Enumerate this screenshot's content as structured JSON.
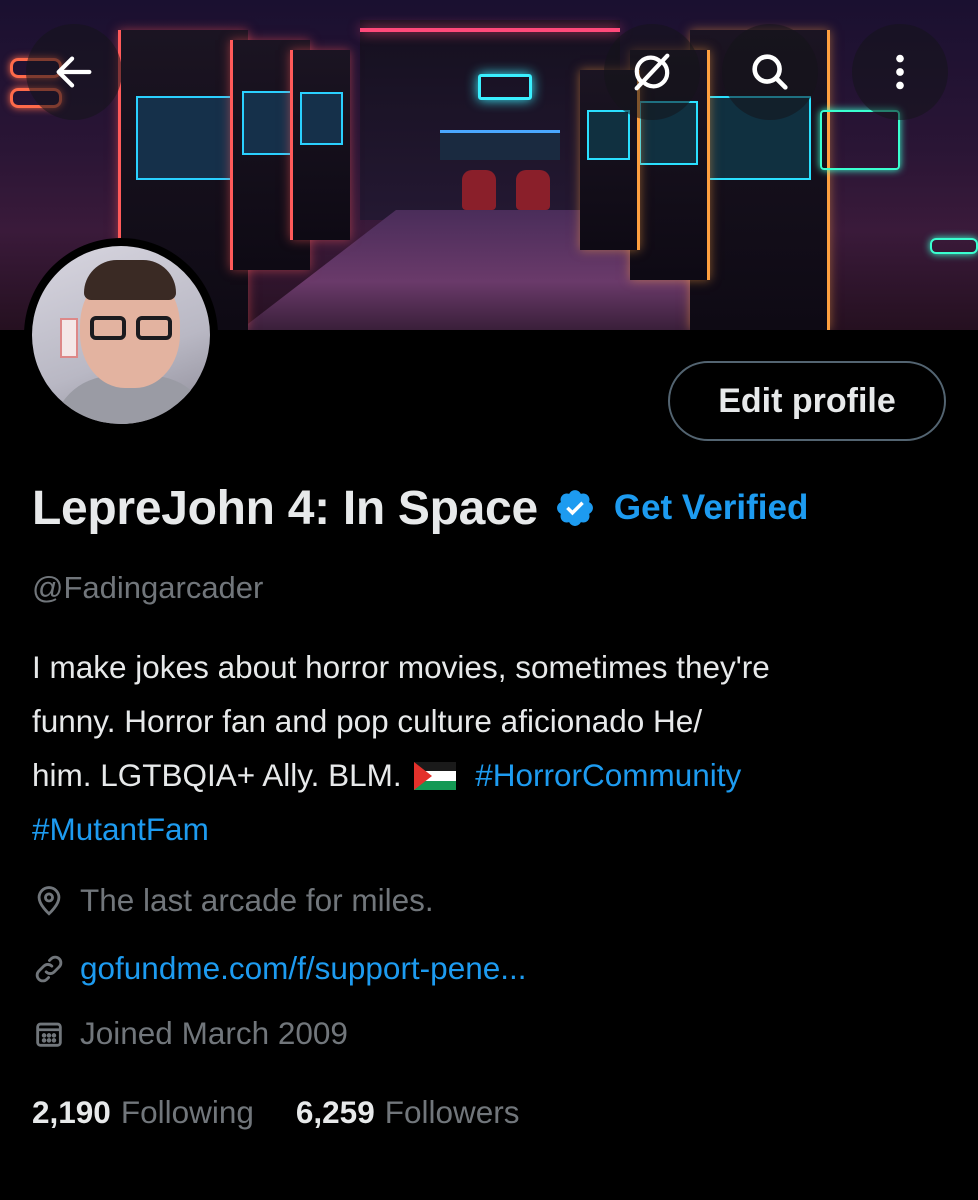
{
  "header": {
    "back_icon": "arrow-left-icon",
    "grok_icon": "grok-slash-circle-icon",
    "search_icon": "search-icon",
    "more_icon": "more-vertical-icon"
  },
  "profile": {
    "edit_button_label": "Edit profile",
    "display_name": "LepreJohn 4: In Space",
    "verified_icon": "verified-badge-icon",
    "get_verified_label": "Get Verified",
    "handle": "@Fadingarcader",
    "bio": {
      "line1": "I make jokes about horror movies, sometimes they're",
      "line2": "funny. Horror fan and pop culture aficionado  He/",
      "line3_text": "him. LGTBQIA+ Ally. BLM.",
      "line3_flag": "palestine-flag-emoji",
      "line3_tag": "#HorrorCommunity",
      "line4_tag": "#MutantFam"
    },
    "location": "The last arcade for miles.",
    "website": "gofundme.com/f/support-pene...",
    "joined": "Joined March 2009",
    "following_count": "2,190",
    "following_label": "Following",
    "followers_count": "6,259",
    "followers_label": "Followers"
  },
  "colors": {
    "accent": "#1d9bf0",
    "background": "#000000",
    "text_primary": "#e7e9ea",
    "text_secondary": "#71767b",
    "border": "#536471"
  }
}
